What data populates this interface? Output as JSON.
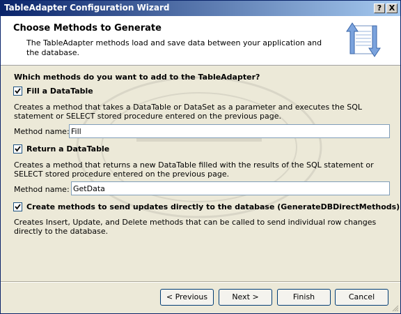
{
  "window": {
    "title": "TableAdapter Configuration Wizard"
  },
  "title_buttons": {
    "help": "?",
    "close": "X"
  },
  "header": {
    "title": "Choose Methods to Generate",
    "description": "The TableAdapter methods load and save data between your application and the database."
  },
  "question": "Which methods do you want to add to the TableAdapter?",
  "fill": {
    "checked": true,
    "label": "Fill a DataTable",
    "description": "Creates a method that takes a DataTable or DataSet as a parameter and executes the SQL statement or SELECT stored procedure entered on the previous page.",
    "method_label": "Method name:",
    "method_value": "Fill"
  },
  "return": {
    "checked": true,
    "label": "Return a DataTable",
    "description": "Creates a method that returns a new DataTable filled with the results of the SQL statement or SELECT stored procedure entered on the previous page.",
    "method_label": "Method name:",
    "method_value": "GetData"
  },
  "direct": {
    "checked": true,
    "label": "Create methods to send updates directly to the database (GenerateDBDirectMethods)",
    "description": "Creates Insert, Update, and Delete methods that can be called to send individual row changes directly to the database."
  },
  "buttons": {
    "previous": "< Previous",
    "next": "Next >",
    "finish": "Finish",
    "cancel": "Cancel"
  },
  "icons": {
    "header": "database-sync-arrows-icon",
    "watermark": "thaicreate-watermark"
  }
}
